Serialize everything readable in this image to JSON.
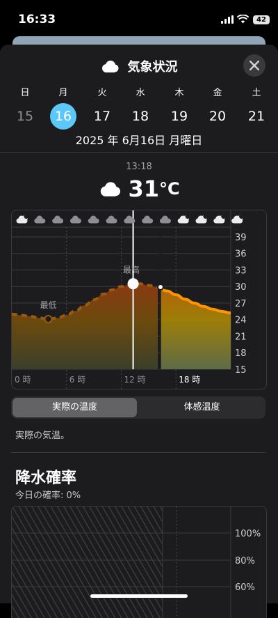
{
  "status_bar": {
    "time": "16:33",
    "battery": "42"
  },
  "sheet": {
    "title": "気象状況",
    "week": [
      {
        "dow": "日",
        "date": "15",
        "state": "past"
      },
      {
        "dow": "月",
        "date": "16",
        "state": "selected"
      },
      {
        "dow": "火",
        "date": "17",
        "state": "future"
      },
      {
        "dow": "水",
        "date": "18",
        "state": "future"
      },
      {
        "dow": "木",
        "date": "19",
        "state": "future"
      },
      {
        "dow": "金",
        "date": "20",
        "state": "future"
      },
      {
        "dow": "土",
        "date": "21",
        "state": "future"
      }
    ],
    "full_date": "2025 年 6月16日 月曜日",
    "current": {
      "time": "13:18",
      "temp": "31",
      "unit": "°C"
    }
  },
  "chart_data": {
    "type": "area",
    "x_tick_labels": [
      "0 時",
      "6 時",
      "12 時",
      "18 時"
    ],
    "y_tick_labels": [
      "39",
      "36",
      "33",
      "30",
      "27",
      "24",
      "21",
      "18",
      "15"
    ],
    "ylim": [
      15,
      39.5
    ],
    "xlim": [
      0,
      24
    ],
    "series": [
      {
        "x": [
          0,
          1,
          2,
          3,
          4,
          5,
          6,
          7,
          8,
          9,
          10,
          11,
          12,
          13,
          14,
          15,
          16,
          17,
          18,
          19,
          20,
          21,
          22,
          23,
          24
        ],
        "values": [
          25,
          24.8,
          24.6,
          24.3,
          24.1,
          24.3,
          24.8,
          25.6,
          26.6,
          27.6,
          28.6,
          29.4,
          30,
          30.4,
          30.5,
          30.2,
          29.8,
          29.2,
          28.5,
          27.7,
          27,
          26.4,
          25.9,
          25.5,
          25.2
        ]
      }
    ],
    "current_x": 13.3,
    "past_end_x": 16.3,
    "markers": [
      {
        "label": "最低",
        "x": 4,
        "value": 24.1
      },
      {
        "label": "最高",
        "x": 13.1,
        "value": 30.5
      }
    ],
    "hour_icons": [
      "moon-cloud",
      "cloud",
      "cloud",
      "cloud",
      "cloud",
      "cloud",
      "cloud",
      "cloud",
      "cloud",
      "sun-cloud",
      "sun-cloud",
      "sun-cloud",
      "sun-cloud"
    ]
  },
  "toggle": {
    "actual": "実際の温度",
    "feels": "体感温度"
  },
  "toggle_description": "実際の気温。",
  "precip": {
    "title": "降水確率",
    "subtitle": "今日の確率: 0%",
    "y_tick_labels": [
      "100%",
      "80%",
      "60%"
    ]
  }
}
